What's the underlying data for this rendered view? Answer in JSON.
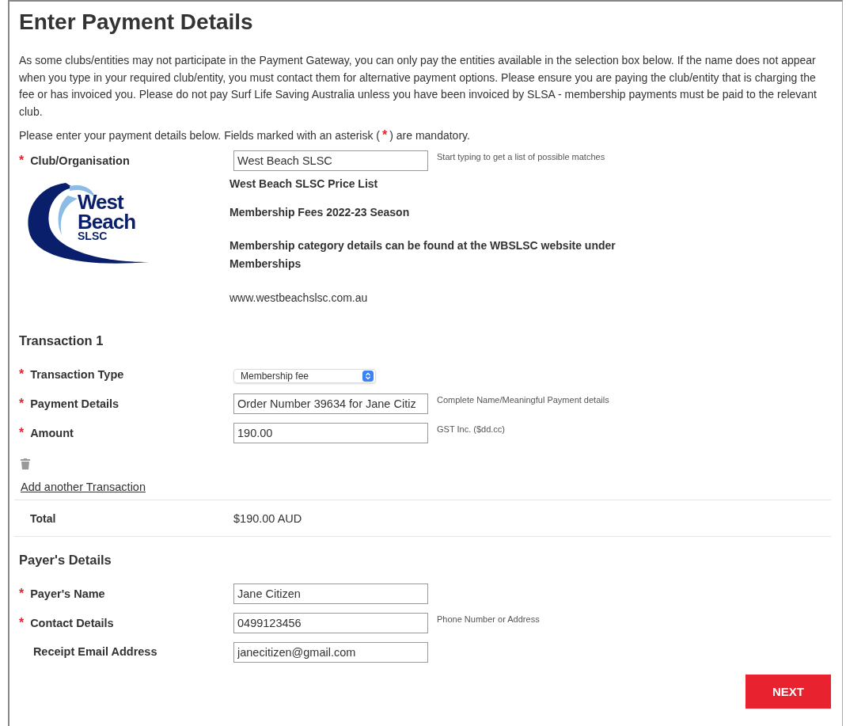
{
  "title": "Enter Payment Details",
  "intro": "As some clubs/entities may not participate in the Payment Gateway, you can only pay the entities available in the selection box below. If the name does not appear when you type in your required club/entity, you must contact them for alternative payment options. Please ensure you are paying the club/entity that is charging the fee or has invoiced you. Please do not pay Surf Life Saving Australia unless you have been invoiced by SLSA - membership payments must be paid to the relevant club.",
  "note": {
    "before": "Please enter your payment details below. Fields marked with an asterisk (",
    "mark": "*",
    "after": ") are mandatory."
  },
  "club": {
    "mark": "*",
    "label": "Club/Organisation",
    "value": "West Beach SLSC",
    "hint": "Start typing to get a list of possible matches"
  },
  "logo": {
    "lines": [
      "West",
      "Beach",
      "SLSC"
    ]
  },
  "club_info": [
    {
      "text": "West Beach SLSC Price List",
      "bold": true
    },
    {
      "text": "Membership Fees 2022-23 Season",
      "bold": true
    },
    {
      "text": "Membership category details can be found at the WBSLSC website under Memberships",
      "bold": true
    },
    {
      "text": "www.westbeachslsc.com.au",
      "bold": false
    }
  ],
  "transaction": {
    "heading": "Transaction 1",
    "fields": [
      {
        "kind": "select",
        "mark": "*",
        "label": "Transaction Type",
        "value": "Membership fee"
      },
      {
        "kind": "input",
        "mark": "*",
        "label": "Payment Details",
        "value": "Order Number 39634 for Jane Citiz",
        "hint": "Complete Name/Meaningful Payment details"
      },
      {
        "kind": "input",
        "mark": "*",
        "label": "Amount",
        "value": "190.00",
        "hint": "GST Inc. ($dd.cc)"
      }
    ],
    "add_link": "Add another Transaction"
  },
  "total": {
    "label": "Total",
    "value": "$190.00 AUD"
  },
  "payer": {
    "heading": "Payer's Details",
    "fields": [
      {
        "kind": "input",
        "mark": "*",
        "label": "Payer's Name",
        "value": "Jane Citizen"
      },
      {
        "kind": "input",
        "mark": "*",
        "label": "Contact Details",
        "value": "0499123456",
        "hint": "Phone Number or Address"
      },
      {
        "kind": "input",
        "label": "Receipt Email Address",
        "value": "janecitizen@gmail.com"
      }
    ]
  },
  "next_button": "NEXT"
}
